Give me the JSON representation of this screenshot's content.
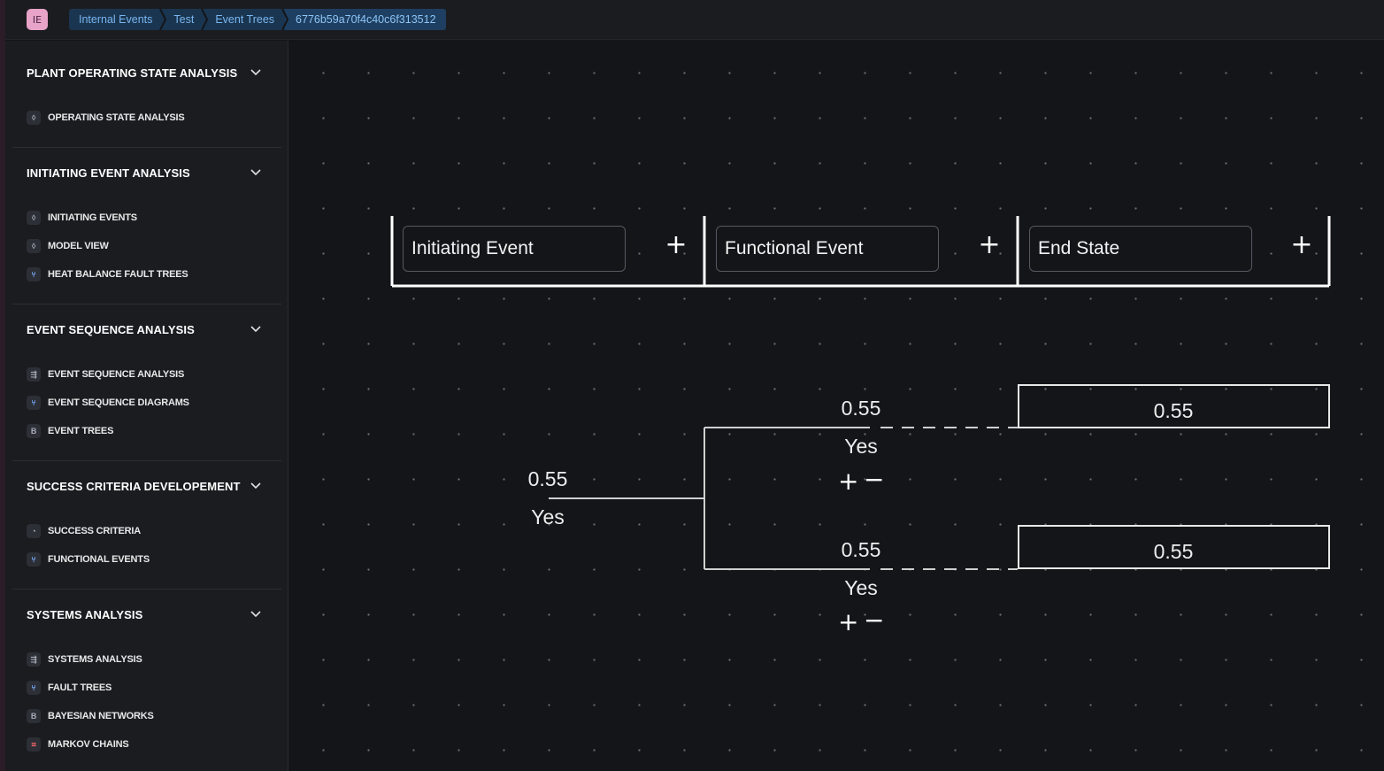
{
  "app": {
    "badge": "IE"
  },
  "breadcrumbs": [
    "Internal Events",
    "Test",
    "Event Trees",
    "6776b59a70f4c40c6f313512"
  ],
  "sidebar": {
    "sections": [
      {
        "title": "PLANT OPERATING STATE ANALYSIS",
        "items": [
          {
            "label": "OPERATING STATE ANALYSIS",
            "icon": "diamond-icon"
          }
        ]
      },
      {
        "title": "INITIATING EVENT ANALYSIS",
        "items": [
          {
            "label": "INITIATING EVENTS",
            "icon": "diamond-icon"
          },
          {
            "label": "MODEL VIEW",
            "icon": "diamond-icon"
          },
          {
            "label": "HEAT BALANCE FAULT TREES",
            "icon": "branch-icon"
          }
        ]
      },
      {
        "title": "EVENT SEQUENCE ANALYSIS",
        "items": [
          {
            "label": "EVENT SEQUENCE ANALYSIS",
            "icon": "sequence-icon"
          },
          {
            "label": "EVENT SEQUENCE DIAGRAMS",
            "icon": "branch-icon"
          },
          {
            "label": "EVENT TREES",
            "icon": "b-icon"
          }
        ]
      },
      {
        "title": "SUCCESS CRITERIA DEVELOPEMENT",
        "items": [
          {
            "label": "SUCCESS CRITERIA",
            "icon": "chart-icon"
          },
          {
            "label": "FUNCTIONAL EVENTS",
            "icon": "branch-icon"
          }
        ]
      },
      {
        "title": "SYSTEMS ANALYSIS",
        "items": [
          {
            "label": "SYSTEMS ANALYSIS",
            "icon": "sequence-icon"
          },
          {
            "label": "FAULT TREES",
            "icon": "branch-icon"
          },
          {
            "label": "BAYESIAN NETWORKS",
            "icon": "b-icon"
          },
          {
            "label": "MARKOV CHAINS",
            "icon": "markov-icon"
          }
        ]
      }
    ]
  },
  "tree": {
    "columns": [
      {
        "value": "Initiating Event",
        "add_label": "+"
      },
      {
        "value": "Functional Event",
        "add_label": "+"
      },
      {
        "value": "End State",
        "add_label": "+"
      }
    ],
    "initiating": {
      "probability": "0.55",
      "label": "Yes"
    },
    "branches": [
      {
        "probability": "0.55",
        "label": "Yes",
        "add": "+",
        "remove": "−",
        "end_state": "0.55"
      },
      {
        "probability": "0.55",
        "label": "Yes",
        "add": "+",
        "remove": "−",
        "end_state": "0.55"
      }
    ]
  },
  "colors": {
    "badge": "#e7a3c8",
    "crumb_bg": "#1a3550",
    "crumb_text": "#79b6f0",
    "line": "#ffffff"
  }
}
